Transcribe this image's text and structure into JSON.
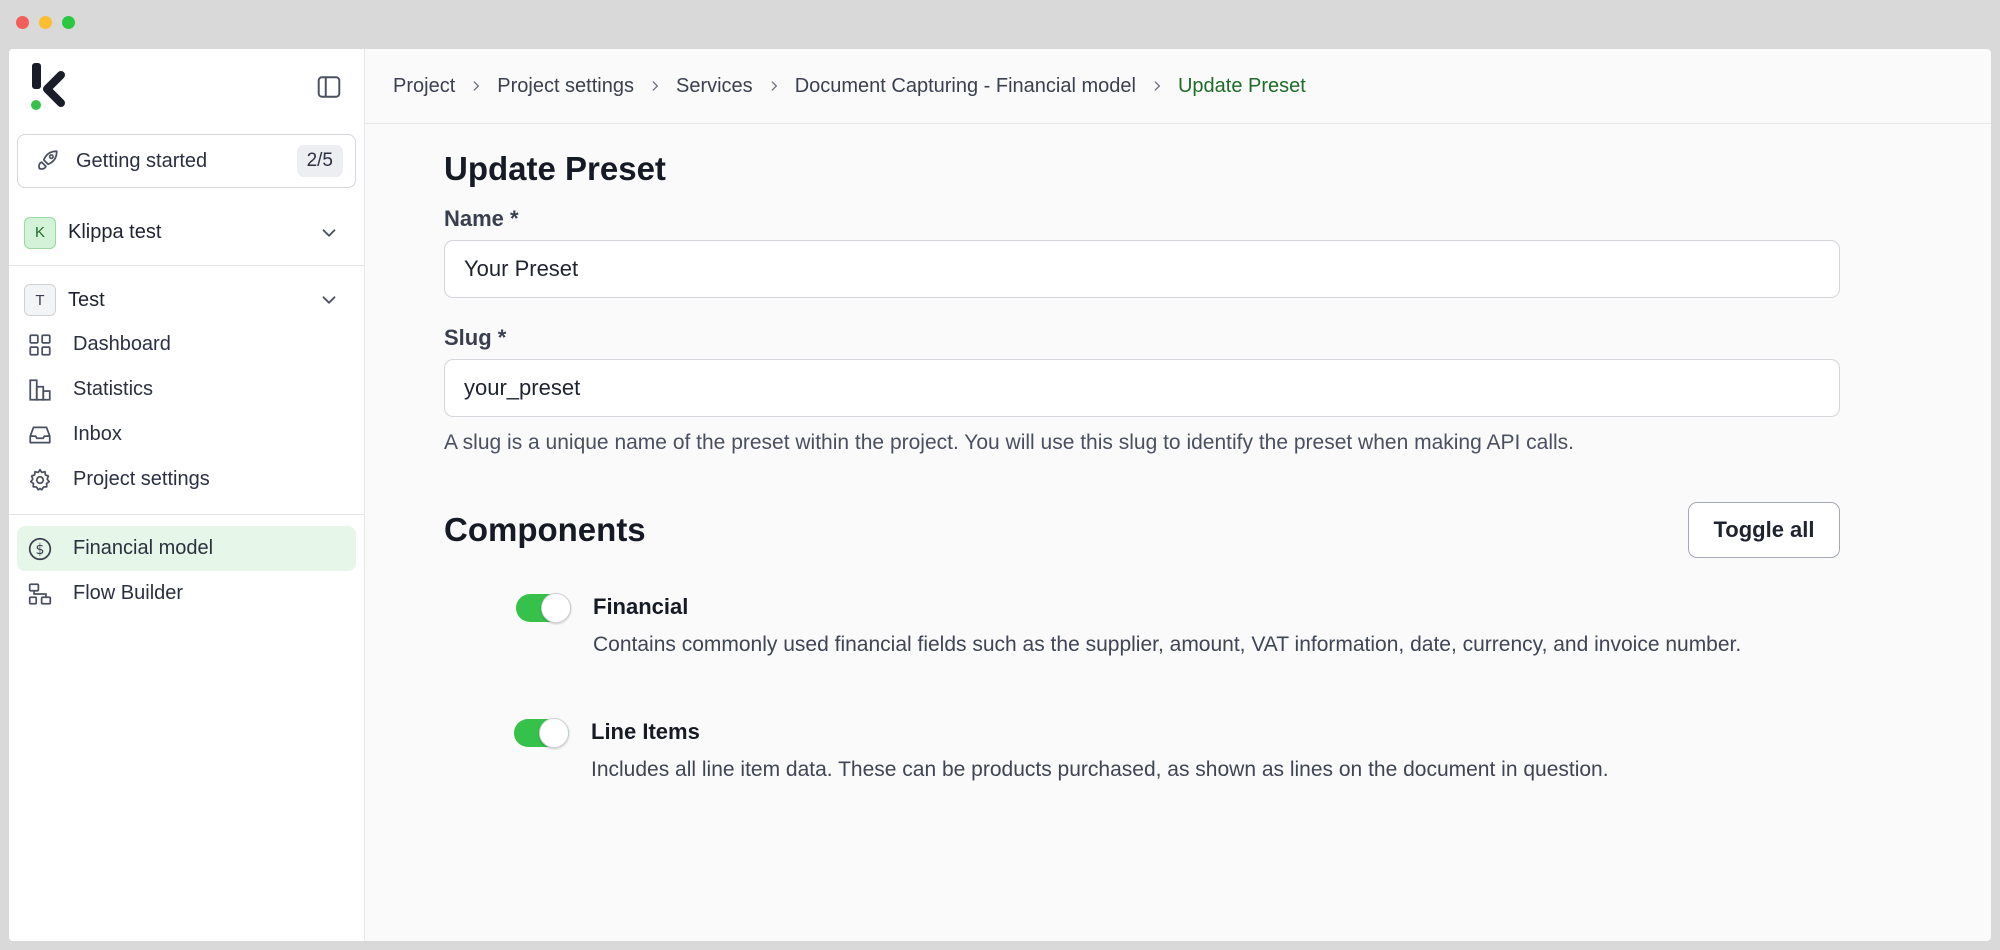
{
  "window_controls": {
    "close": "#f25f58",
    "minimize": "#fbbe2e",
    "zoom": "#2ac840"
  },
  "brand": {
    "accent": "#35c14a",
    "active_bg": "#e6f6e8"
  },
  "sidebar": {
    "getting_started": {
      "label": "Getting started",
      "progress": "2/5"
    },
    "workspace": {
      "initial": "K",
      "name": "Klippa test"
    },
    "project": {
      "initial": "T",
      "name": "Test"
    },
    "nav": [
      {
        "label": "Dashboard",
        "icon": "grid-icon"
      },
      {
        "label": "Statistics",
        "icon": "bar-chart-icon"
      },
      {
        "label": "Inbox",
        "icon": "inbox-icon"
      },
      {
        "label": "Project settings",
        "icon": "gear-icon"
      }
    ],
    "services": [
      {
        "label": "Financial model",
        "icon": "dollar-circle-icon",
        "active": true
      },
      {
        "label": "Flow Builder",
        "icon": "flow-icon",
        "active": false
      }
    ]
  },
  "breadcrumb": [
    "Project",
    "Project settings",
    "Services",
    "Document Capturing - Financial model",
    "Update Preset"
  ],
  "form": {
    "title": "Update Preset",
    "name_label": "Name *",
    "name_value": "Your Preset",
    "slug_label": "Slug *",
    "slug_value": "your_preset",
    "slug_hint": "A slug is a unique name of the preset within the project. You will use this slug to identify the preset when making API calls."
  },
  "components": {
    "title": "Components",
    "toggle_all_label": "Toggle all",
    "items": [
      {
        "title": "Financial",
        "description": "Contains commonly used financial fields such as the supplier, amount, VAT information, date, currency, and invoice number.",
        "enabled": true
      },
      {
        "title": "Line Items",
        "description": "Includes all line item data. These can be products purchased, as shown as lines on the document in question.",
        "enabled": true
      }
    ]
  }
}
